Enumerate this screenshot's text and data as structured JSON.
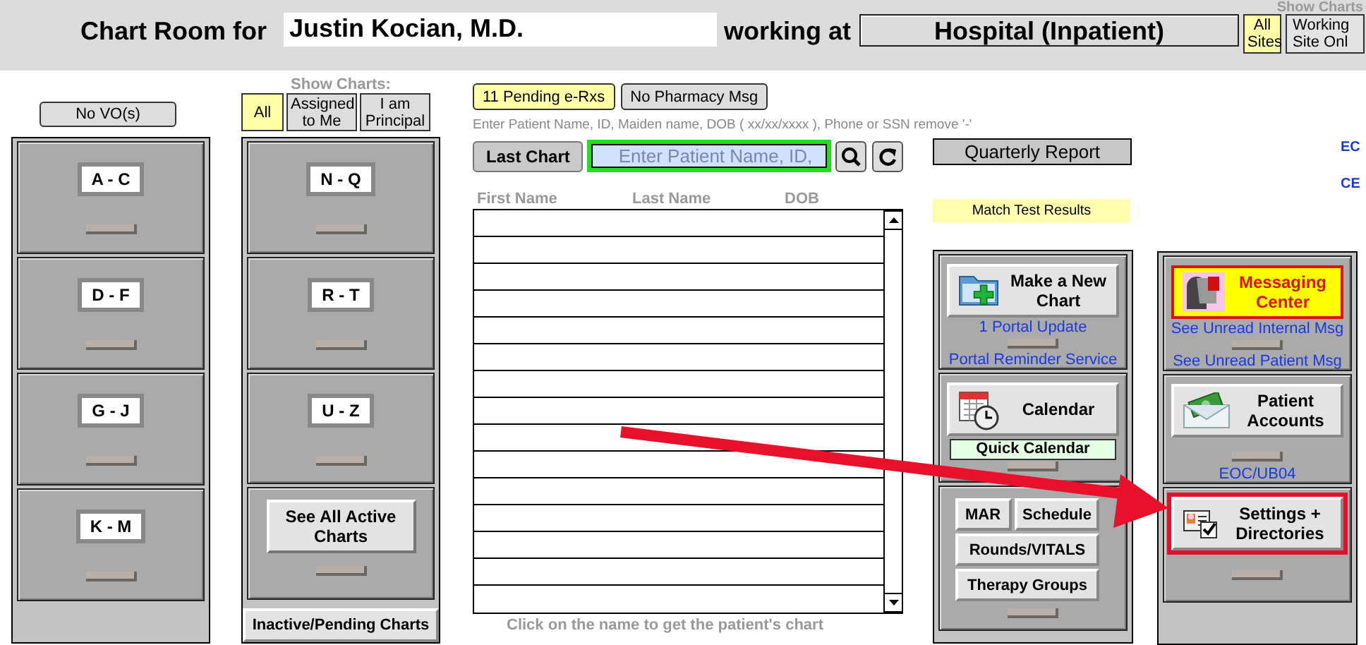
{
  "header": {
    "title": "Chart Room for",
    "user": "Justin Kocian, M.D.",
    "working_at_label": "working at",
    "site": "Hospital (Inpatient)",
    "show_charts_label": "Show Charts",
    "site_filters": [
      {
        "label": "All Sites",
        "selected": true
      },
      {
        "label": "Working Site Onl",
        "selected": false
      }
    ]
  },
  "no_vo_button": "No VO(s)",
  "show_charts": {
    "label": "Show Charts:",
    "filters": [
      {
        "label": "All",
        "selected": true
      },
      {
        "label": "Assigned to Me",
        "selected": false
      },
      {
        "label": "I am Principal",
        "selected": false
      }
    ]
  },
  "messages": [
    {
      "label": "11 Pending e-Rxs",
      "pending": true
    },
    {
      "label": "No Pharmacy Msg",
      "pending": false
    }
  ],
  "search": {
    "hint": "Enter Patient Name, ID, Maiden name, DOB ( xx/xx/xxxx ), Phone or SSN remove '-'",
    "last_chart_button": "Last Chart",
    "placeholder": "Enter Patient Name, ID,"
  },
  "patient_list": {
    "columns": [
      "First Name",
      "Last Name",
      "DOB"
    ],
    "caption": "Click on the name to get the patient's chart"
  },
  "quarterly_report_button": "Quarterly Report",
  "match_test_results": "Match Test Results",
  "side_links": [
    "EC",
    "CE"
  ],
  "cabinets": [
    {
      "drawers": [
        {
          "kind": "label",
          "label": "A - C"
        },
        {
          "kind": "label",
          "label": "D - F"
        },
        {
          "kind": "label",
          "label": "G - J"
        },
        {
          "kind": "label",
          "label": "K - M"
        }
      ]
    },
    {
      "drawers": [
        {
          "kind": "label",
          "label": "N - Q"
        },
        {
          "kind": "label",
          "label": "R - T"
        },
        {
          "kind": "label",
          "label": "U - Z"
        },
        {
          "kind": "button",
          "label": "See All Active Charts"
        }
      ],
      "footer_button": "Inactive/Pending Charts"
    },
    {
      "drawers": [
        {
          "kind": "feature",
          "label": "Make a New Chart",
          "links_above": [
            "1 Portal Update"
          ],
          "links_below": [
            "Portal Reminder Service"
          ],
          "alert": false,
          "highlighted": false
        },
        {
          "kind": "feature",
          "label": "Calendar",
          "sub_button": "Quick Calendar",
          "alert": false,
          "highlighted": false
        },
        {
          "kind": "button_grid",
          "rows": [
            [
              "MAR",
              "Schedule"
            ],
            [
              "Rounds/VITALS"
            ],
            [
              "Therapy Groups"
            ]
          ]
        }
      ]
    },
    {
      "drawers": [
        {
          "kind": "feature",
          "label": "Messaging Center",
          "links_above": [
            "See Unread Internal Msg"
          ],
          "links_below": [
            "See Unread Patient Msg"
          ],
          "alert": true,
          "highlighted": false
        },
        {
          "kind": "feature",
          "label": "Patient Accounts",
          "links_below": [
            "EOC/UB04"
          ],
          "alert": false,
          "highlighted": false
        },
        {
          "kind": "feature",
          "label": "Settings + Directories",
          "alert": false,
          "highlighted": true
        }
      ]
    }
  ]
}
